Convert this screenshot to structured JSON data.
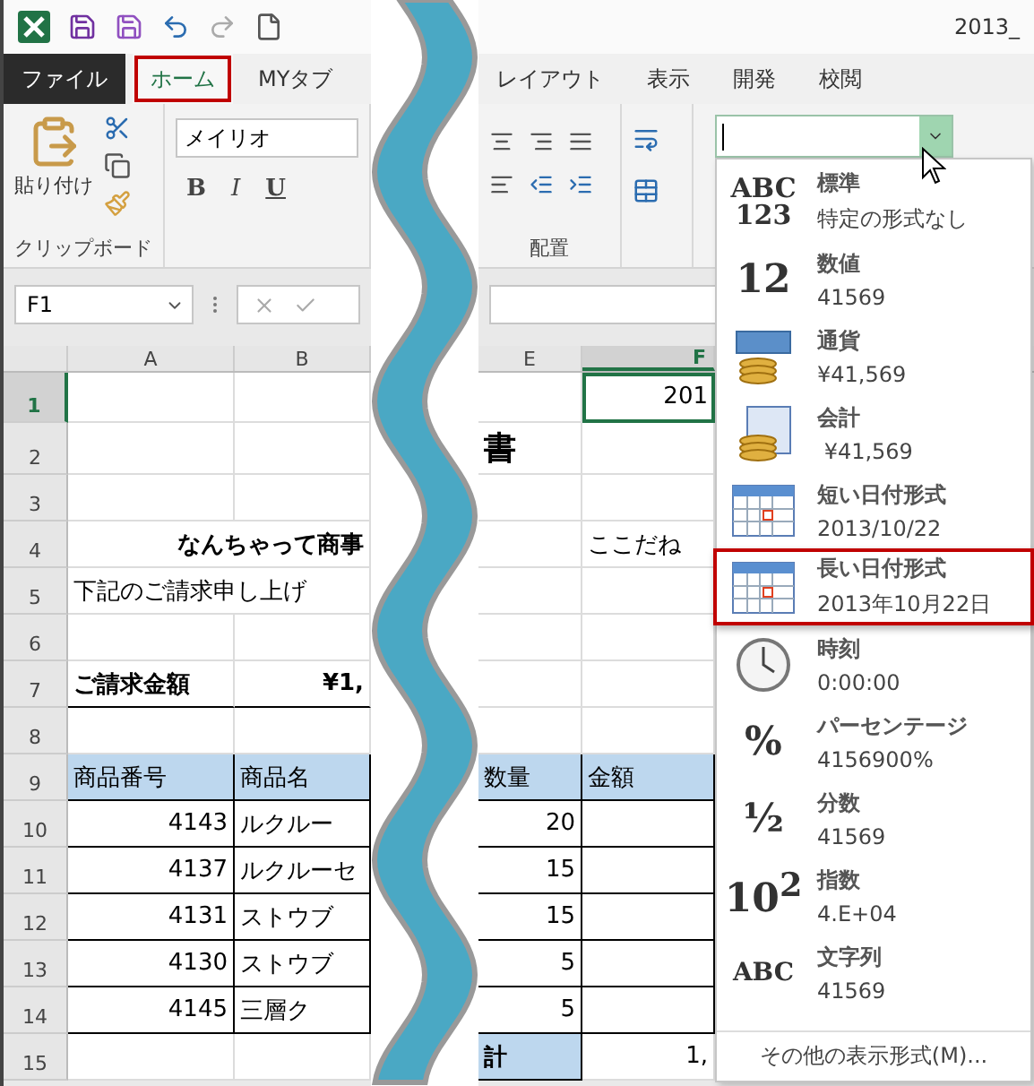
{
  "title_bar": {
    "title": "2013_"
  },
  "tabs": [
    {
      "label": "ファイル",
      "kind": "file",
      "selected": false
    },
    {
      "label": "ホーム",
      "kind": "tab",
      "selected": true
    },
    {
      "label": "MYタブ",
      "kind": "tab",
      "selected": false
    },
    {
      "label": "レイアウト",
      "kind": "tab",
      "selected": false
    },
    {
      "label": "表示",
      "kind": "tab",
      "selected": false
    },
    {
      "label": "開発",
      "kind": "tab",
      "selected": false
    },
    {
      "label": "校閲",
      "kind": "tab",
      "selected": false
    }
  ],
  "ribbon": {
    "paste_label": "貼り付け",
    "clipboard_group": "クリップボード",
    "font_name": "メイリオ",
    "font_buttons": [
      "B",
      "I",
      "U"
    ],
    "alignment_group": "配置"
  },
  "formula_bar": {
    "name_box": "F1"
  },
  "columns": [
    {
      "label": "A",
      "selected": false
    },
    {
      "label": "B",
      "selected": false
    },
    {
      "label": "E",
      "selected": false
    },
    {
      "label": "F",
      "selected": true
    }
  ],
  "rows": [
    {
      "number": "1",
      "selected": true,
      "framed": false,
      "ruled": false,
      "cells": {
        "f": {
          "text": "201",
          "kind": "num",
          "selected": true
        }
      }
    },
    {
      "number": "2",
      "selected": false,
      "framed": false,
      "ruled": false,
      "cells": {
        "e": {
          "text": "書",
          "kind": "title"
        }
      }
    },
    {
      "number": "3",
      "selected": false,
      "framed": false,
      "ruled": false,
      "cells": {}
    },
    {
      "number": "4",
      "selected": false,
      "framed": false,
      "ruled": false,
      "cells": {
        "a": {
          "text": "なんちゃって商事",
          "kind": "bold_wide"
        },
        "f": {
          "text": "ここだね",
          "kind": "text"
        }
      }
    },
    {
      "number": "5",
      "selected": false,
      "framed": false,
      "ruled": false,
      "cells": {
        "a": {
          "text": "下記のご請求申し上げ",
          "kind": "wide"
        }
      }
    },
    {
      "number": "6",
      "selected": false,
      "framed": false,
      "ruled": false,
      "cells": {}
    },
    {
      "number": "7",
      "selected": false,
      "framed": false,
      "ruled": true,
      "cells": {
        "a": {
          "text": "ご請求金額",
          "kind": "bold"
        },
        "b": {
          "text": "¥1,",
          "kind": "bold_num"
        }
      }
    },
    {
      "number": "8",
      "selected": false,
      "framed": false,
      "ruled": false,
      "cells": {}
    },
    {
      "number": "9",
      "selected": false,
      "framed": true,
      "ruled": false,
      "cells": {
        "a": {
          "text": "商品番号",
          "kind": "head"
        },
        "b": {
          "text": "商品名",
          "kind": "head"
        },
        "e": {
          "text": "数量",
          "kind": "head"
        },
        "f": {
          "text": "金額",
          "kind": "head"
        }
      }
    },
    {
      "number": "10",
      "selected": false,
      "framed": true,
      "ruled": false,
      "cells": {
        "a": {
          "text": "4143",
          "kind": "num"
        },
        "b": {
          "text": "ルクルー",
          "kind": "text"
        },
        "e": {
          "text": "20",
          "kind": "num"
        },
        "f": {
          "kind": "num"
        }
      }
    },
    {
      "number": "11",
      "selected": false,
      "framed": true,
      "ruled": false,
      "cells": {
        "a": {
          "text": "4137",
          "kind": "num"
        },
        "b": {
          "text": "ルクルーセ",
          "kind": "text"
        },
        "e": {
          "text": "15",
          "kind": "num"
        },
        "f": {
          "kind": "num"
        }
      }
    },
    {
      "number": "12",
      "selected": false,
      "framed": true,
      "ruled": false,
      "cells": {
        "a": {
          "text": "4131",
          "kind": "num"
        },
        "b": {
          "text": "ストウブ",
          "kind": "text"
        },
        "e": {
          "text": "15",
          "kind": "num"
        },
        "f": {
          "kind": "num"
        }
      }
    },
    {
      "number": "13",
      "selected": false,
      "framed": true,
      "ruled": false,
      "cells": {
        "a": {
          "text": "4130",
          "kind": "num"
        },
        "b": {
          "text": "ストウブ",
          "kind": "text"
        },
        "e": {
          "text": "5",
          "kind": "num"
        },
        "f": {
          "kind": "num"
        }
      }
    },
    {
      "number": "14",
      "selected": false,
      "framed": true,
      "ruled": false,
      "cells": {
        "a": {
          "text": "4145",
          "kind": "num"
        },
        "b": {
          "text": "三層ク",
          "kind": "text"
        },
        "e": {
          "text": "5",
          "kind": "num"
        },
        "f": {
          "kind": "num"
        }
      }
    },
    {
      "number": "15",
      "selected": false,
      "framed": false,
      "ruled": false,
      "cells": {
        "e": {
          "text": "計",
          "kind": "total"
        },
        "f": {
          "text": "1,",
          "kind": "num"
        }
      }
    }
  ],
  "format_menu": {
    "items": [
      {
        "name": "標準",
        "sample": "特定の形式なし",
        "kind": "glyph",
        "glyph": "ABC 123",
        "selected": false
      },
      {
        "name": "数値",
        "sample": "41569",
        "kind": "glyph",
        "glyph": "12",
        "selected": false
      },
      {
        "name": "通貨",
        "sample": "¥41,569",
        "kind": "currency",
        "selected": false
      },
      {
        "name": "会計",
        "sample": " ¥41,569",
        "kind": "accounting",
        "selected": false
      },
      {
        "name": "短い日付形式",
        "sample": "2013/10/22",
        "kind": "calendar",
        "selected": false
      },
      {
        "name": "長い日付形式",
        "sample": "2013年10月22日",
        "kind": "calendar",
        "selected": true
      },
      {
        "name": "時刻",
        "sample": "0:00:00",
        "kind": "clock",
        "selected": false
      },
      {
        "name": "パーセンテージ",
        "sample": "4156900%",
        "kind": "glyph",
        "glyph": "%",
        "selected": false
      },
      {
        "name": "分数",
        "sample": "41569",
        "kind": "glyph",
        "glyph": "½",
        "selected": false
      },
      {
        "name": "指数",
        "sample": "4.E+04",
        "kind": "glyph",
        "glyph": "10$^{2}$",
        "selected": false
      },
      {
        "name": "文字列",
        "sample": "41569",
        "kind": "glyph",
        "glyph": "ABC",
        "selected": false
      }
    ],
    "more": "その他の表示形式(M)..."
  }
}
